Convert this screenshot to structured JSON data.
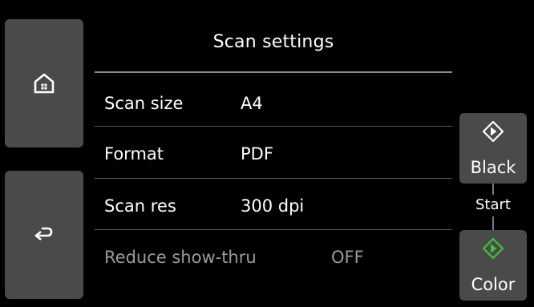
{
  "title": "Scan settings",
  "nav": {
    "home_icon": "home-icon",
    "back_icon": "back-arrow-icon"
  },
  "settings": [
    {
      "label": "Scan size",
      "value": "A4"
    },
    {
      "label": "Format",
      "value": "PDF"
    },
    {
      "label": "Scan res",
      "value": "300 dpi"
    },
    {
      "label": "Reduce show-thru",
      "value": "OFF"
    }
  ],
  "start": {
    "heading": "Start",
    "black_label": "Black",
    "color_label": "Color",
    "black_icon": "diamond-start-icon",
    "color_icon": "diamond-start-icon",
    "color_icon_color": "#3cc43c"
  }
}
